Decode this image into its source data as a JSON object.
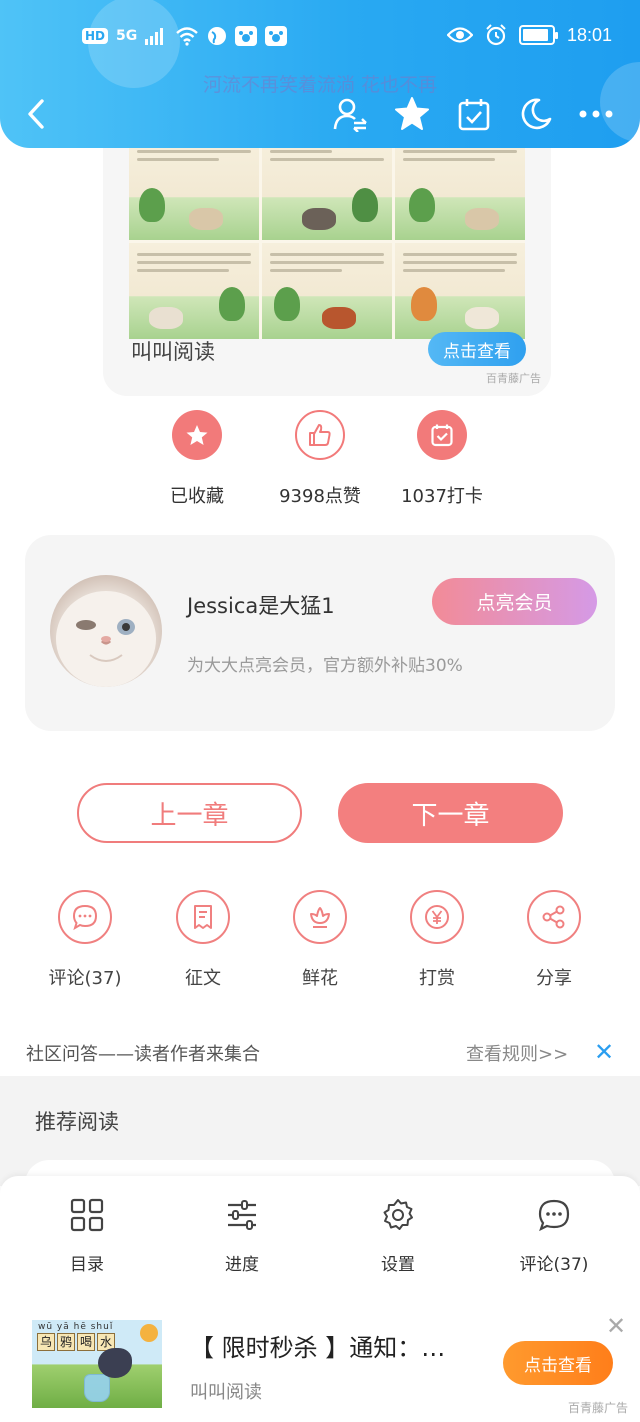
{
  "status_bar": {
    "left_badges": [
      "HD",
      "5G"
    ],
    "time": "18:01",
    "battery_level": 0.9,
    "icons": [
      "signal-icon",
      "wifi-icon",
      "globe-icon",
      "paw-icon",
      "paw-icon",
      "eye-icon",
      "alarm-icon",
      "battery-icon"
    ]
  },
  "header": {
    "overlay_title": "河流不再笑着流淌 花也不再",
    "colors": {
      "header_start": "#4fc3f7",
      "header_end": "#1e9ef0"
    },
    "nav_icons": [
      "back-icon",
      "user-switch-icon",
      "star-icon",
      "calendar-check-icon",
      "moon-icon",
      "more-icon"
    ]
  },
  "top_ad": {
    "app_name": "叫叫阅读",
    "button_label": "点击查看",
    "ad_tag": "百青藤广告"
  },
  "stats": [
    {
      "label": "已收藏",
      "icon": "star-icon"
    },
    {
      "label": "9398点赞",
      "icon": "thumbs-up-icon"
    },
    {
      "label": "1037打卡",
      "icon": "calendar-check-icon"
    }
  ],
  "member": {
    "user_name": "Jessica是大猛1",
    "description": "为大大点亮会员，官方额外补贴30%",
    "button_label": "点亮会员"
  },
  "chapter_nav": {
    "prev_label": "上一章",
    "next_label": "下一章"
  },
  "actions": [
    {
      "label": "评论(37)",
      "icon": "comment-icon"
    },
    {
      "label": "征文",
      "icon": "document-icon"
    },
    {
      "label": "鲜花",
      "icon": "flower-icon"
    },
    {
      "label": "打赏",
      "icon": "yen-coin-icon"
    },
    {
      "label": "分享",
      "icon": "share-icon"
    }
  ],
  "community": {
    "title": "社区问答——读者作者来集合",
    "rules_link": "查看规则>>"
  },
  "recommend": {
    "title": "推荐阅读"
  },
  "bottom_nav": [
    {
      "label": "目录",
      "icon": "grid-icon"
    },
    {
      "label": "进度",
      "icon": "sliders-icon"
    },
    {
      "label": "设置",
      "icon": "gear-icon"
    },
    {
      "label": "评论(37)",
      "icon": "comment-icon"
    }
  ],
  "bottom_ad": {
    "title": "【 限时秒杀 】通知：…",
    "subtitle": "叫叫阅读",
    "button_label": "点击查看",
    "ad_tag": "百青藤广告",
    "image_pinyin": "wū  yā  hē  shuǐ",
    "image_hanzi": [
      "乌",
      "鸦",
      "喝",
      "水"
    ]
  },
  "theme": {
    "accent_red": "#f37f7f",
    "accent_blue": "#2a9ef0",
    "accent_orange": "#ff8a24"
  }
}
